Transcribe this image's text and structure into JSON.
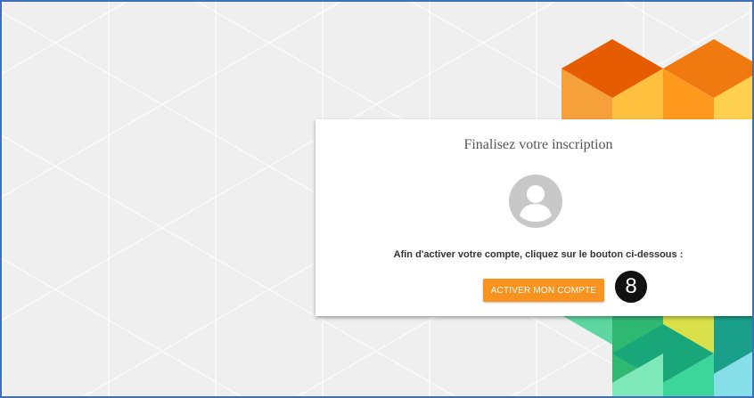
{
  "card": {
    "title": "Finalisez votre inscription",
    "avatar_icon": "user-circle-icon",
    "instruction": "Afin d'activer votre compte, cliquez sur le bouton ci-dessous :",
    "activate_button_label": "ACTIVER MON COMPTE"
  },
  "step_badge": {
    "number": "8"
  },
  "colors": {
    "button": "#f7931e",
    "border": "#3e6fb7",
    "background": "#efefef",
    "avatar": "#c8c8c8"
  }
}
